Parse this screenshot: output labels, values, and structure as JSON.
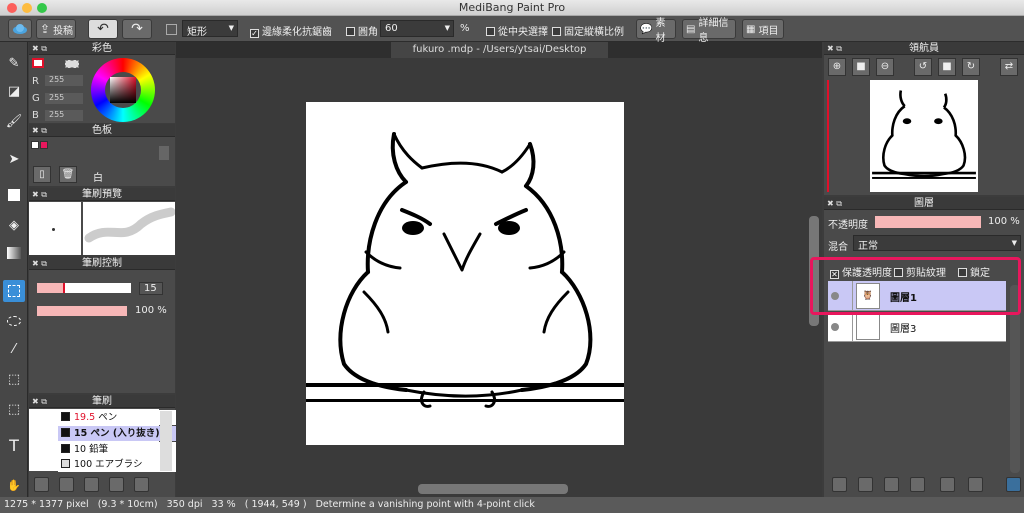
{
  "app": {
    "title": "MediBang Paint Pro"
  },
  "toolbar": {
    "post": "投稿",
    "shape": "矩形",
    "antialias": "邊緣柔化抗鋸齒",
    "round_corner": "圓角",
    "round_value": "60",
    "percent": "%",
    "center_select": "從中央選擇",
    "fixed_ratio": "固定縱橫比例",
    "material": "素材",
    "detail": "詳細信息",
    "items": "項目"
  },
  "color_panel": {
    "title": "彩色",
    "r_label": "R",
    "g_label": "G",
    "b_label": "B",
    "r": "255",
    "g": "255",
    "b": "255"
  },
  "palette_panel": {
    "title": "色板",
    "white_label": "白"
  },
  "brush_preview_panel": {
    "title": "筆刷預覽"
  },
  "brush_control_panel": {
    "title": "筆刷控制",
    "size": "15",
    "opacity": "100 %"
  },
  "brush_panel": {
    "title": "筆刷",
    "items": [
      {
        "size": "19.5",
        "name": "ペン",
        "color": "#111111"
      },
      {
        "size": "15",
        "name": "ペン (入り抜き)",
        "color": "#111111"
      },
      {
        "size": "10",
        "name": "鉛筆",
        "color": "#111111"
      },
      {
        "size": "100",
        "name": "エアブラシ",
        "color": "#dddddd"
      }
    ]
  },
  "document": {
    "tab": "fukuro .mdp - /Users/ytsai/Desktop"
  },
  "navigator": {
    "title": "領航員"
  },
  "layers": {
    "title": "圖層",
    "opacity_label": "不透明度",
    "opacity_value": "100 %",
    "opacity_fraction": 1.0,
    "blend_label": "混合",
    "blend_value": "正常",
    "protect_alpha": "保護透明度",
    "clipping": "剪貼紋理",
    "lock": "鎖定",
    "items": [
      {
        "name": "圖層1"
      },
      {
        "name": "圖層3"
      }
    ]
  },
  "status": {
    "text": "1275 * 1377 pixel   (9.3 * 10cm)   350 dpi   33 %   ( 1944, 549 )   Determine a vanishing point with 4-point click"
  },
  "colors": {
    "accent_red": "#e8175d",
    "highlight": "#c9c8f5",
    "fg_color": "#e0102a"
  }
}
